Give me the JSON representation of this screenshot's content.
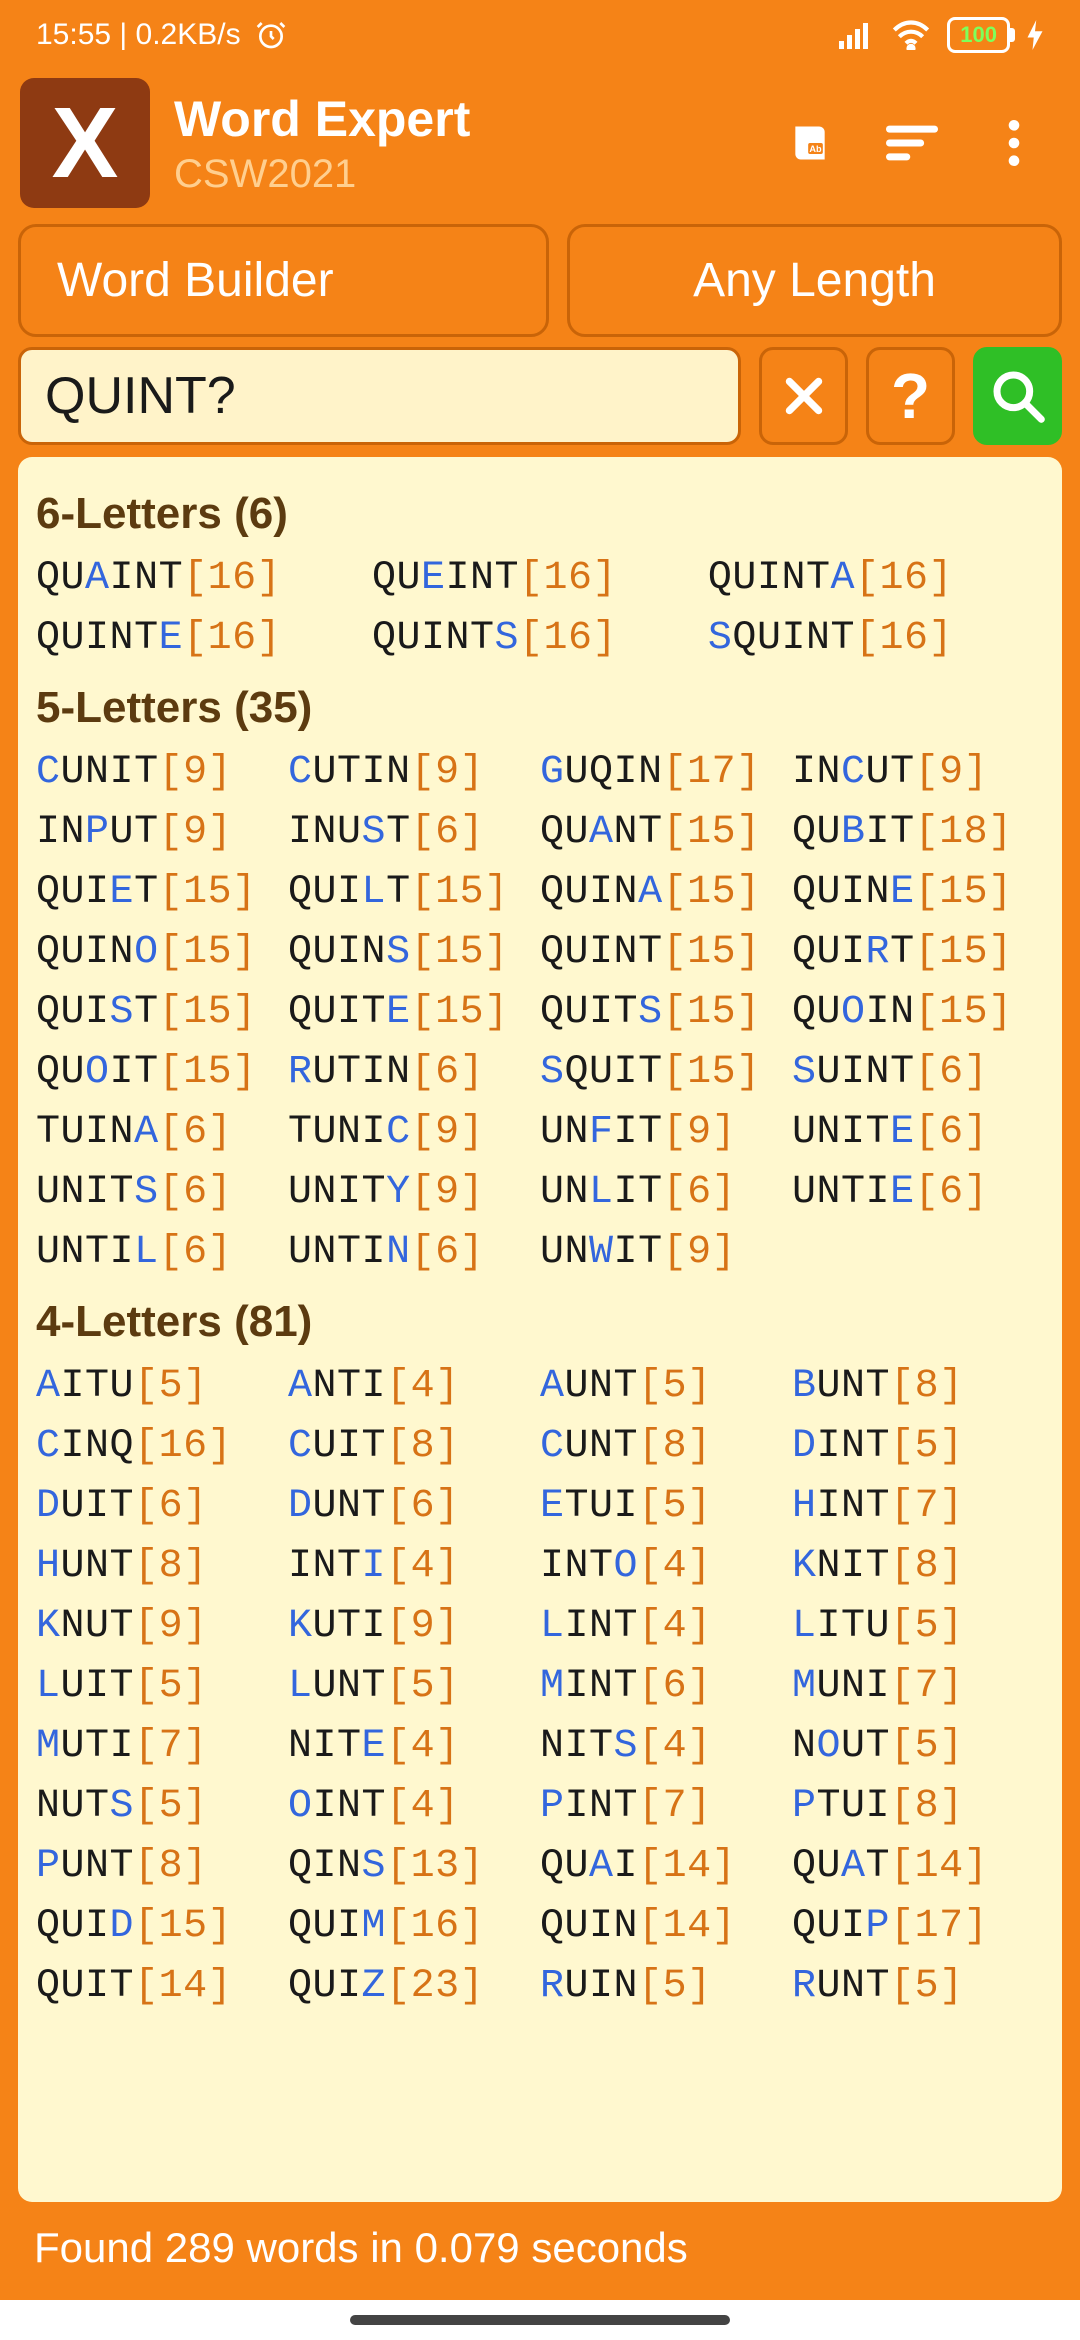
{
  "status": {
    "left_text": "15:55 | 0.2KB/s",
    "battery": "100"
  },
  "header": {
    "title": "Word Expert",
    "subtitle": "CSW2021"
  },
  "selectors": {
    "mode": "Word Builder",
    "length": "Any Length"
  },
  "search": {
    "query": "QUINT?"
  },
  "footer": {
    "text": "Found 289 words in 0.079 seconds"
  },
  "sections": [
    {
      "title": "6-Letters (6)",
      "cls": "w6",
      "words": [
        {
          "w": "QUAINT",
          "wild": [
            2
          ],
          "s": 16
        },
        {
          "w": "QUEINT",
          "wild": [
            2
          ],
          "s": 16
        },
        {
          "w": "QUINTA",
          "wild": [
            5
          ],
          "s": 16
        },
        {
          "w": "QUINTE",
          "wild": [
            5
          ],
          "s": 16
        },
        {
          "w": "QUINTS",
          "wild": [
            5
          ],
          "s": 16
        },
        {
          "w": "SQUINT",
          "wild": [
            0
          ],
          "s": 16
        }
      ]
    },
    {
      "title": "5-Letters (35)",
      "cls": "w5",
      "words": [
        {
          "w": "CUNIT",
          "wild": [
            0
          ],
          "s": 9
        },
        {
          "w": "CUTIN",
          "wild": [
            0
          ],
          "s": 9
        },
        {
          "w": "GUQIN",
          "wild": [
            0
          ],
          "s": 17
        },
        {
          "w": "INCUT",
          "wild": [
            2
          ],
          "s": 9
        },
        {
          "w": "INPUT",
          "wild": [
            2
          ],
          "s": 9
        },
        {
          "w": "INUST",
          "wild": [
            3
          ],
          "s": 6
        },
        {
          "w": "QUANT",
          "wild": [
            2
          ],
          "s": 15
        },
        {
          "w": "QUBIT",
          "wild": [
            2
          ],
          "s": 18
        },
        {
          "w": "QUIET",
          "wild": [
            3
          ],
          "s": 15
        },
        {
          "w": "QUILT",
          "wild": [
            3
          ],
          "s": 15
        },
        {
          "w": "QUINA",
          "wild": [
            4
          ],
          "s": 15
        },
        {
          "w": "QUINE",
          "wild": [
            4
          ],
          "s": 15
        },
        {
          "w": "QUINO",
          "wild": [
            4
          ],
          "s": 15
        },
        {
          "w": "QUINS",
          "wild": [
            4
          ],
          "s": 15
        },
        {
          "w": "QUINT",
          "wild": [],
          "s": 15
        },
        {
          "w": "QUIRT",
          "wild": [
            3
          ],
          "s": 15
        },
        {
          "w": "QUIST",
          "wild": [
            3
          ],
          "s": 15
        },
        {
          "w": "QUITE",
          "wild": [
            4
          ],
          "s": 15
        },
        {
          "w": "QUITS",
          "wild": [
            4
          ],
          "s": 15
        },
        {
          "w": "QUOIN",
          "wild": [
            2
          ],
          "s": 15
        },
        {
          "w": "QUOIT",
          "wild": [
            2
          ],
          "s": 15
        },
        {
          "w": "RUTIN",
          "wild": [
            0
          ],
          "s": 6
        },
        {
          "w": "SQUIT",
          "wild": [
            0
          ],
          "s": 15
        },
        {
          "w": "SUINT",
          "wild": [
            0
          ],
          "s": 6
        },
        {
          "w": "TUINA",
          "wild": [
            4
          ],
          "s": 6
        },
        {
          "w": "TUNIC",
          "wild": [
            4
          ],
          "s": 9
        },
        {
          "w": "UNFIT",
          "wild": [
            2
          ],
          "s": 9
        },
        {
          "w": "UNITE",
          "wild": [
            4
          ],
          "s": 6
        },
        {
          "w": "UNITS",
          "wild": [
            4
          ],
          "s": 6
        },
        {
          "w": "UNITY",
          "wild": [
            4
          ],
          "s": 9
        },
        {
          "w": "UNLIT",
          "wild": [
            2
          ],
          "s": 6
        },
        {
          "w": "UNTIE",
          "wild": [
            4
          ],
          "s": 6
        },
        {
          "w": "UNTIL",
          "wild": [
            4
          ],
          "s": 6
        },
        {
          "w": "UNTIN",
          "wild": [
            4
          ],
          "s": 6
        },
        {
          "w": "UNWIT",
          "wild": [
            2
          ],
          "s": 9
        }
      ]
    },
    {
      "title": "4-Letters (81)",
      "cls": "w4",
      "words": [
        {
          "w": "AITU",
          "wild": [
            0
          ],
          "s": 5
        },
        {
          "w": "ANTI",
          "wild": [
            0
          ],
          "s": 4
        },
        {
          "w": "AUNT",
          "wild": [
            0
          ],
          "s": 5
        },
        {
          "w": "BUNT",
          "wild": [
            0
          ],
          "s": 8
        },
        {
          "w": "CINQ",
          "wild": [
            0
          ],
          "s": 16
        },
        {
          "w": "CUIT",
          "wild": [
            0
          ],
          "s": 8
        },
        {
          "w": "CUNT",
          "wild": [
            0
          ],
          "s": 8
        },
        {
          "w": "DINT",
          "wild": [
            0
          ],
          "s": 5
        },
        {
          "w": "DUIT",
          "wild": [
            0
          ],
          "s": 6
        },
        {
          "w": "DUNT",
          "wild": [
            0
          ],
          "s": 6
        },
        {
          "w": "ETUI",
          "wild": [
            0
          ],
          "s": 5
        },
        {
          "w": "HINT",
          "wild": [
            0
          ],
          "s": 7
        },
        {
          "w": "HUNT",
          "wild": [
            0
          ],
          "s": 8
        },
        {
          "w": "INTI",
          "wild": [
            3
          ],
          "s": 4
        },
        {
          "w": "INTO",
          "wild": [
            3
          ],
          "s": 4
        },
        {
          "w": "KNIT",
          "wild": [
            0
          ],
          "s": 8
        },
        {
          "w": "KNUT",
          "wild": [
            0
          ],
          "s": 9
        },
        {
          "w": "KUTI",
          "wild": [
            0
          ],
          "s": 9
        },
        {
          "w": "LINT",
          "wild": [
            0
          ],
          "s": 4
        },
        {
          "w": "LITU",
          "wild": [
            0
          ],
          "s": 5
        },
        {
          "w": "LUIT",
          "wild": [
            0
          ],
          "s": 5
        },
        {
          "w": "LUNT",
          "wild": [
            0
          ],
          "s": 5
        },
        {
          "w": "MINT",
          "wild": [
            0
          ],
          "s": 6
        },
        {
          "w": "MUNI",
          "wild": [
            0
          ],
          "s": 7
        },
        {
          "w": "MUTI",
          "wild": [
            0
          ],
          "s": 7
        },
        {
          "w": "NITE",
          "wild": [
            3
          ],
          "s": 4
        },
        {
          "w": "NITS",
          "wild": [
            3
          ],
          "s": 4
        },
        {
          "w": "NOUT",
          "wild": [
            1
          ],
          "s": 5
        },
        {
          "w": "NUTS",
          "wild": [
            3
          ],
          "s": 5
        },
        {
          "w": "OINT",
          "wild": [
            0
          ],
          "s": 4
        },
        {
          "w": "PINT",
          "wild": [
            0
          ],
          "s": 7
        },
        {
          "w": "PTUI",
          "wild": [
            0
          ],
          "s": 8
        },
        {
          "w": "PUNT",
          "wild": [
            0
          ],
          "s": 8
        },
        {
          "w": "QINS",
          "wild": [
            3
          ],
          "s": 13
        },
        {
          "w": "QUAI",
          "wild": [
            2
          ],
          "s": 14
        },
        {
          "w": "QUAT",
          "wild": [
            2
          ],
          "s": 14
        },
        {
          "w": "QUID",
          "wild": [
            3
          ],
          "s": 15
        },
        {
          "w": "QUIM",
          "wild": [
            3
          ],
          "s": 16
        },
        {
          "w": "QUIN",
          "wild": [],
          "s": 14
        },
        {
          "w": "QUIP",
          "wild": [
            3
          ],
          "s": 17
        },
        {
          "w": "QUIT",
          "wild": [],
          "s": 14
        },
        {
          "w": "QUIZ",
          "wild": [
            3
          ],
          "s": 23
        },
        {
          "w": "RUIN",
          "wild": [
            0
          ],
          "s": 5
        },
        {
          "w": "RUNT",
          "wild": [
            0
          ],
          "s": 5
        }
      ]
    }
  ]
}
